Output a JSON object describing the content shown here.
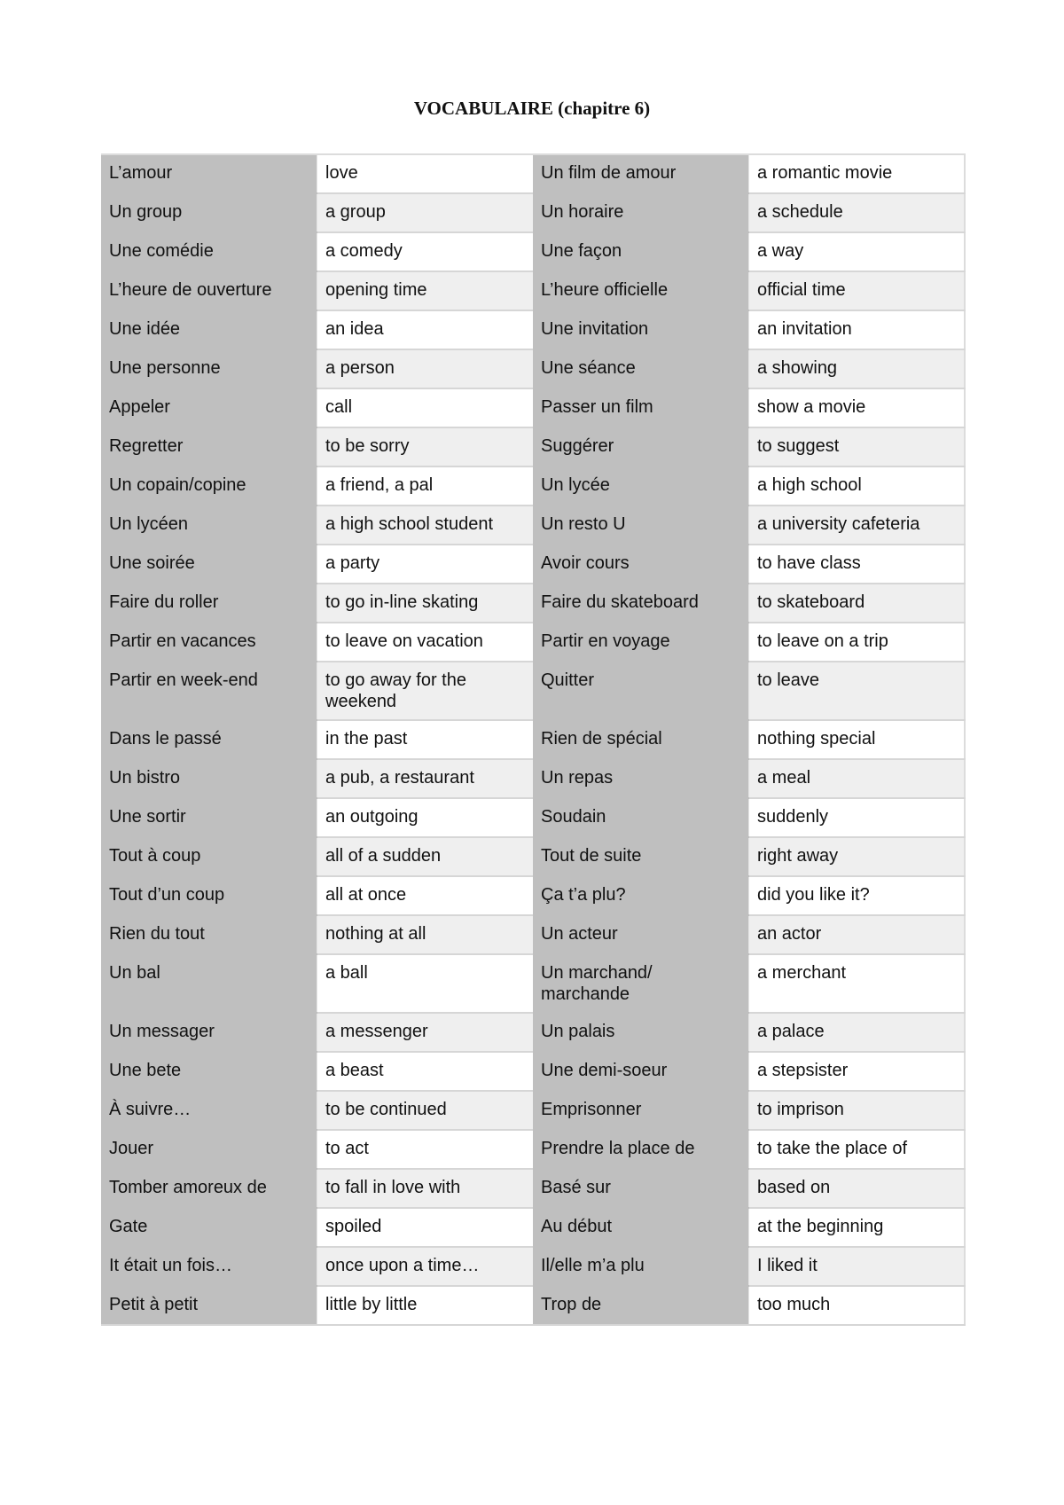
{
  "document": {
    "title": "VOCABULAIRE (chapitre 6)"
  },
  "colors": {
    "french_cell_bg": "#bfbfbf",
    "english_cell_bg_odd": "#ffffff",
    "english_cell_bg_even": "#efefef",
    "grid_line": "#d6d6d6"
  },
  "table": {
    "rows": [
      {
        "fr1": "L’amour",
        "en1": "love",
        "fr2": "Un film de amour",
        "en2": "a romantic movie"
      },
      {
        "fr1": "Un group",
        "en1": "a group",
        "fr2": "Un horaire",
        "en2": "a schedule"
      },
      {
        "fr1": "Une comédie",
        "en1": "a comedy",
        "fr2": "Une façon",
        "en2": "a way"
      },
      {
        "fr1": "L’heure de ouverture",
        "en1": "opening time",
        "fr2": "L’heure officielle",
        "en2": "official time"
      },
      {
        "fr1": "Une idée",
        "en1": "an idea",
        "fr2": "Une invitation",
        "en2": "an invitation"
      },
      {
        "fr1": "Une personne",
        "en1": "a person",
        "fr2": "Une séance",
        "en2": "a showing"
      },
      {
        "fr1": "Appeler",
        "en1": "call",
        "fr2": "Passer un film",
        "en2": "show a movie"
      },
      {
        "fr1": "Regretter",
        "en1": "to be sorry",
        "fr2": "Suggérer",
        "en2": "to suggest"
      },
      {
        "fr1": "Un copain/copine",
        "en1": "a friend, a pal",
        "fr2": "Un lycée",
        "en2": "a high school"
      },
      {
        "fr1": "Un lycéen",
        "en1": "a high school student",
        "fr2": "Un resto U",
        "en2": "a university cafeteria"
      },
      {
        "fr1": "Une soirée",
        "en1": "a party",
        "fr2": "Avoir cours",
        "en2": "to have class"
      },
      {
        "fr1": "Faire du roller",
        "en1": "to go in-line skating",
        "fr2": "Faire du skateboard",
        "en2": "to skateboard"
      },
      {
        "fr1": "Partir en vacances",
        "en1": "to leave on vacation",
        "fr2": "Partir en voyage",
        "en2": "to leave on a trip"
      },
      {
        "fr1": "Partir en week-end",
        "en1": "to go away for the weekend",
        "fr2": "Quitter",
        "en2": "to leave"
      },
      {
        "fr1": "Dans le passé",
        "en1": "in the past",
        "fr2": "Rien de spécial",
        "en2": "nothing special"
      },
      {
        "fr1": "Un bistro",
        "en1": "a pub, a restaurant",
        "fr2": "Un repas",
        "en2": "a meal"
      },
      {
        "fr1": "Une sortir",
        "en1": "an outgoing",
        "fr2": "Soudain",
        "en2": "suddenly"
      },
      {
        "fr1": "Tout à coup",
        "en1": "all of a sudden",
        "fr2": "Tout de suite",
        "en2": "right away"
      },
      {
        "fr1": "Tout d’un coup",
        "en1": "all at once",
        "fr2": "Ça t’a plu?",
        "en2": "did you like it?"
      },
      {
        "fr1": "Rien du tout",
        "en1": "nothing at all",
        "fr2": "Un acteur",
        "en2": "an actor"
      },
      {
        "fr1": "Un bal",
        "en1": "a ball",
        "fr2": "Un marchand/ marchande",
        "en2": "a merchant"
      },
      {
        "fr1": "Un messager",
        "en1": "a messenger",
        "fr2": "Un palais",
        "en2": "a palace"
      },
      {
        "fr1": "Une bete",
        "en1": "a beast",
        "fr2": "Une demi-soeur",
        "en2": "a stepsister"
      },
      {
        "fr1": "À suivre…",
        "en1": "to be continued",
        "fr2": "Emprisonner",
        "en2": "to imprison"
      },
      {
        "fr1": "Jouer",
        "en1": "to act",
        "fr2": "Prendre la place de",
        "en2": "to take the place of"
      },
      {
        "fr1": "Tomber amoreux de",
        "en1": "to fall in love with",
        "fr2": "Basé sur",
        "en2": "based on"
      },
      {
        "fr1": "Gate",
        "en1": "spoiled",
        "fr2": "Au début",
        "en2": "at the beginning"
      },
      {
        "fr1": "It était un fois…",
        "en1": "once upon a time…",
        "fr2": "Il/elle m’a plu",
        "en2": "I liked it"
      },
      {
        "fr1": "Petit à petit",
        "en1": "little by little",
        "fr2": "Trop de",
        "en2": "too much"
      }
    ]
  }
}
